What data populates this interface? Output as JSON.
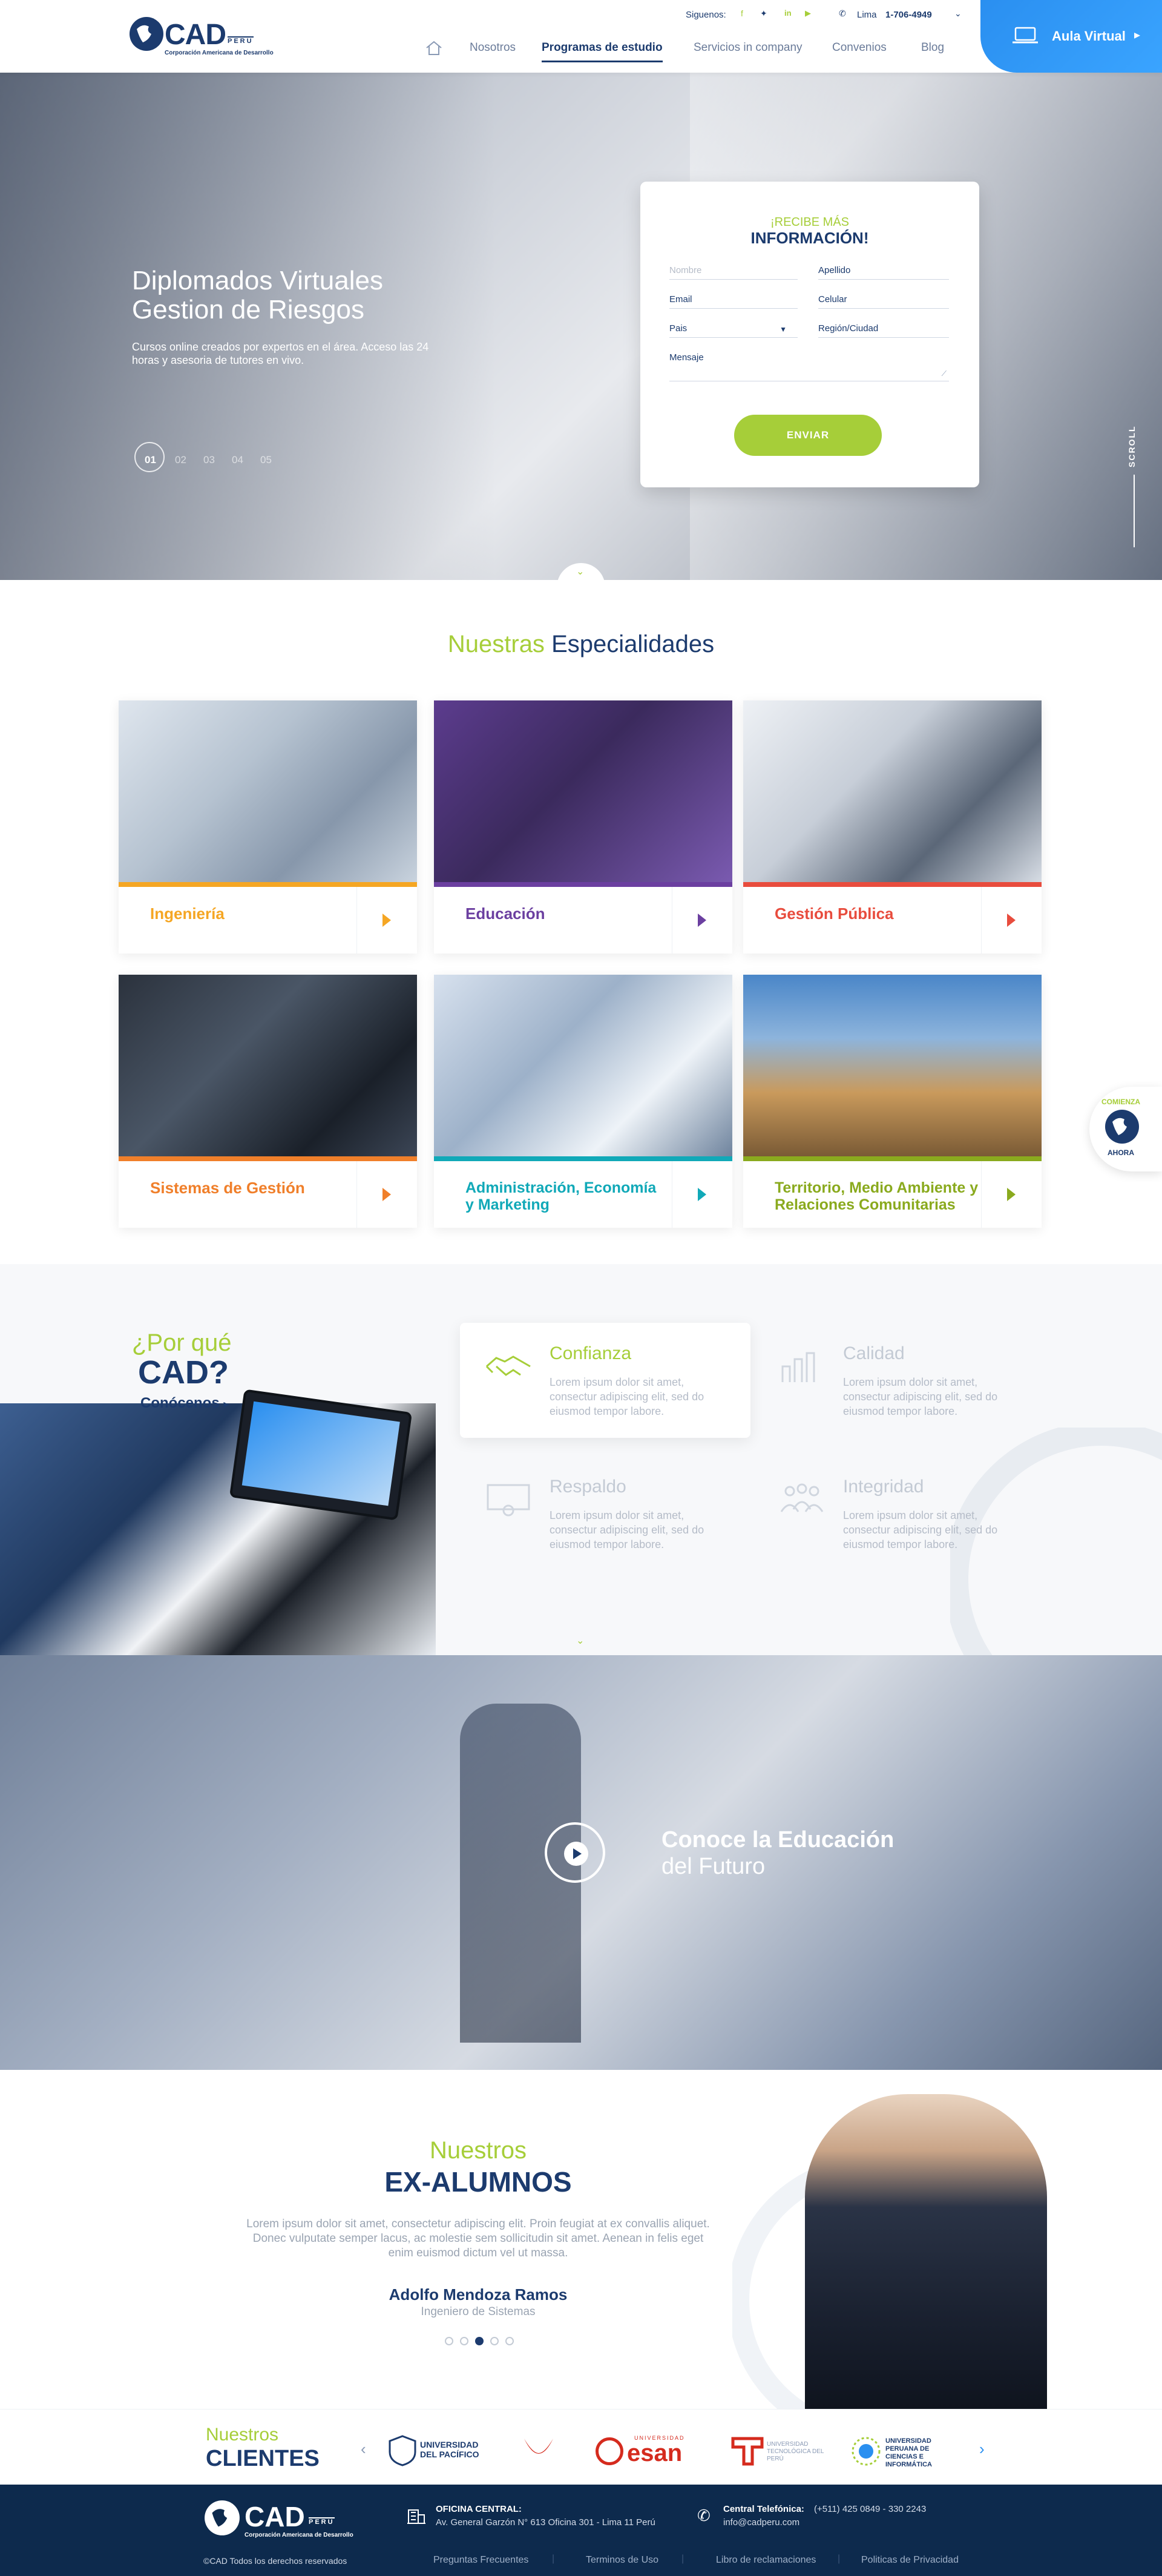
{
  "brand": {
    "name": "CAD",
    "country": "PERU",
    "subtitle": "Corporación Americana de Desarrollo"
  },
  "topbar": {
    "follow": "Siguenos:",
    "city": "Lima",
    "phone": "1-706-4949"
  },
  "nav": {
    "items": [
      "Nosotros",
      "Programas de estudio",
      "Servicios in company",
      "Convenios",
      "Blog"
    ],
    "active": "Programas de estudio"
  },
  "aula": {
    "label": "Aula Virtual"
  },
  "hero": {
    "title_line1": "Diplomados Virtuales",
    "title_line2": "Gestion de Riesgos",
    "desc": "Cursos online creados por expertos en el área. Acceso las 24 horas y asesoria de tutores en vivo.",
    "pages": [
      "01",
      "02",
      "03",
      "04",
      "05"
    ],
    "scroll": "SCROLL"
  },
  "form": {
    "title_top": "¡RECIBE MÁS",
    "title_bottom": "INFORMACIÓN!",
    "nombre": "Nombre",
    "apellido": "Apellido",
    "email": "Email",
    "celular": "Celular",
    "pais": "Pais",
    "region": "Región/Ciudad",
    "mensaje": "Mensaje",
    "submit": "ENVIAR"
  },
  "especialidades": {
    "title_a": "Nuestras",
    "title_b": "Especialidades",
    "cards": [
      {
        "label": "Ingeniería",
        "color": "#f5a623"
      },
      {
        "label": "Educación",
        "color": "#6b3fa0"
      },
      {
        "label": "Gestión Pública",
        "color": "#e84c3d"
      },
      {
        "label": "Sistemas de Gestión",
        "color": "#f07f2a"
      },
      {
        "label": "Administración, Economía y Marketing",
        "color": "#11a9b8"
      },
      {
        "label": "Territorio, Medio Ambiente y Relaciones Comunitarias",
        "color": "#8aaa1e"
      }
    ]
  },
  "comienza": {
    "top": "COMIENZA",
    "bottom": "AHORA"
  },
  "why": {
    "q": "¿Por qué",
    "cad": "CAD?",
    "link": "Conócenos",
    "features": [
      {
        "title": "Confianza",
        "desc": "Lorem ipsum dolor sit amet, consectur adipiscing elit, sed do eiusmod tempor labore."
      },
      {
        "title": "Calidad",
        "desc": "Lorem ipsum dolor sit amet, consectur adipiscing elit, sed do eiusmod tempor labore."
      },
      {
        "title": "Respaldo",
        "desc": "Lorem ipsum dolor sit amet, consectur adipiscing elit, sed do eiusmod tempor labore."
      },
      {
        "title": "Integridad",
        "desc": "Lorem ipsum dolor sit amet, consectur adipiscing elit, sed do eiusmod tempor labore."
      }
    ]
  },
  "video": {
    "line1": "Conoce la Educación",
    "line2": "del Futuro"
  },
  "alumni": {
    "title_a": "Nuestros",
    "title_b": "EX-ALUMNOS",
    "text": "Lorem ipsum dolor sit amet, consectetur adipiscing elit. Proin feugiat at ex convallis aliquet. Donec vulputate semper lacus, ac molestie sem sollicitudin sit amet. Aenean in felis eget enim euismod dictum vel ut massa.",
    "name": "Adolfo Mendoza Ramos",
    "role": "Ingeniero de Sistemas"
  },
  "clients": {
    "title_a": "Nuestros",
    "title_b": "CLIENTES",
    "logos": [
      "UNIVERSIDAD DEL PACÍFICO",
      "UPC",
      "esan",
      "UNIVERSIDAD TECNOLÓGICA DEL PERÚ",
      "UNIVERSIDAD PERUANA DE CIENCIAS E INFORMÁTICA"
    ],
    "logo_esan_small": "UNIVERSIDAD"
  },
  "footer": {
    "office_label": "OFICINA CENTRAL:",
    "office": "Av. General Garzón N° 613 Oficina 301 - Lima 11 Perú",
    "phone_label": "Central Telefónica:",
    "phone": "(+511) 425 0849 - 330 2243",
    "email": "info@cadperu.com",
    "copyright": "©CAD Todos los derechos reservados",
    "links": [
      "Preguntas Frecuentes",
      "Terminos de Uso",
      "Libro de reclamaciones",
      "Politicas de Privacidad"
    ]
  }
}
